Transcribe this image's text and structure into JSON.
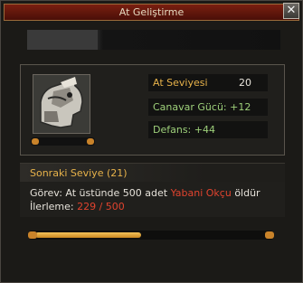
{
  "window": {
    "title": "At Geliştirme",
    "close_label": "✕"
  },
  "horse": {
    "level_label": "At Seviyesi",
    "level_value": "20",
    "monster_power": "Canavar Gücü: +12",
    "defense": "Defans: +44",
    "icon": "armored-horse-icon"
  },
  "next_level": {
    "header": "Sonraki Seviye (21)",
    "task_prefix": "Görev: At üstünde 500 adet",
    "task_target": "Yabani Okçu",
    "task_suffix": "öldür",
    "progress_label": "İlerleme:",
    "progress_text": "229 / 500",
    "progress_fraction": 0.458
  },
  "colors": {
    "gold": "#e7b24a",
    "green": "#9ed07a",
    "red": "#e0432e"
  }
}
